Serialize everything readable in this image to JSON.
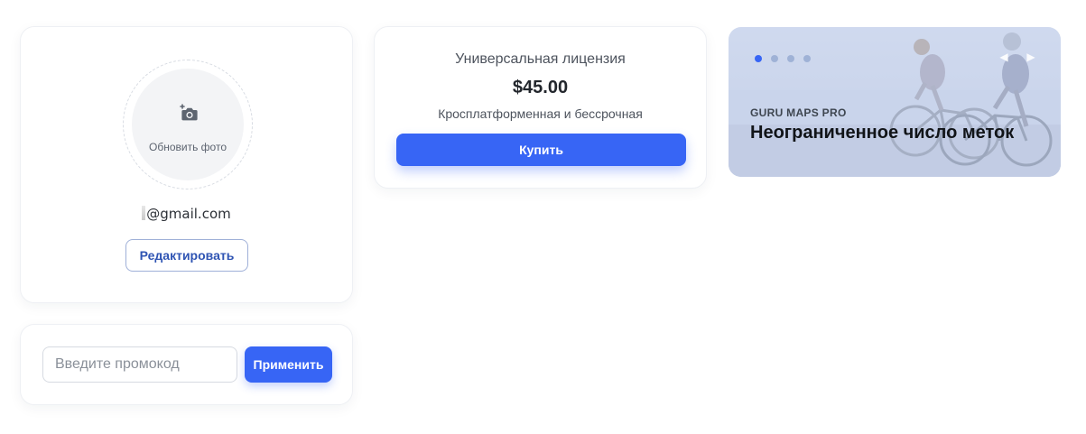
{
  "profile": {
    "avatar_label": "Обновить фото",
    "email": "@gmail.com",
    "edit_label": "Редактировать"
  },
  "promo": {
    "placeholder": "Введите промокод",
    "apply_label": "Применить"
  },
  "license": {
    "title": "Универсальная лицензия",
    "price": "$45.00",
    "description": "Кросплатформенная и бессрочная",
    "buy_label": "Купить"
  },
  "banner": {
    "kicker": "GURU MAPS PRO",
    "title": "Неограниченное число меток",
    "slides_total": 4,
    "active_slide": 1,
    "prev_icon": "chevron-left-icon",
    "next_icon": "play-next-icon"
  },
  "colors": {
    "accent": "#3765f5",
    "outline_text": "#2f54b3",
    "banner_tint": "#c9d5ec"
  }
}
